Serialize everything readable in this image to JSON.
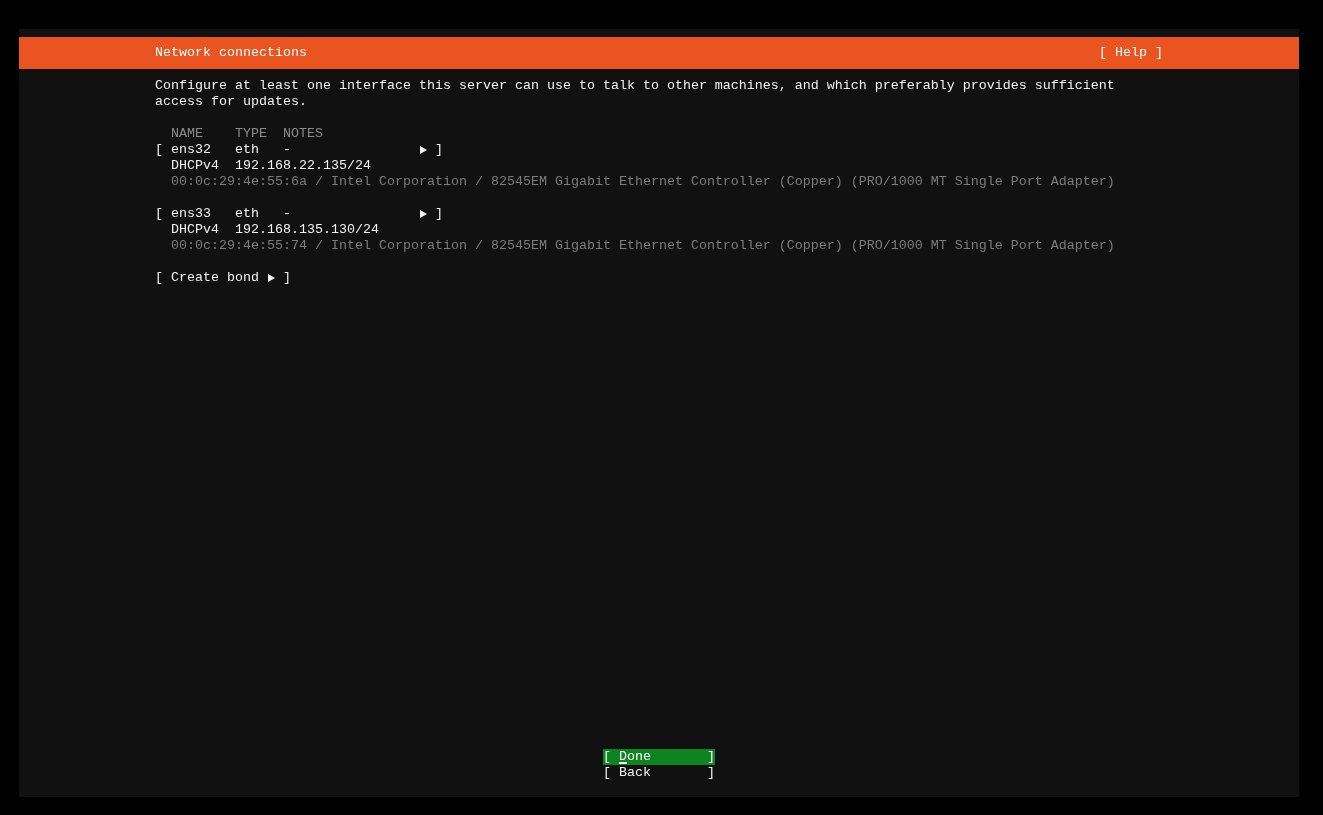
{
  "header": {
    "title": "Network connections",
    "help": "[ Help ]"
  },
  "intro": "Configure at least one interface this server can use to talk to other machines, and which preferably provides sufficient access for updates.",
  "table": {
    "columns": [
      "NAME",
      "TYPE",
      "NOTES"
    ],
    "interfaces": [
      {
        "open": "[",
        "name": "ens32",
        "type": "eth",
        "notes": "-",
        "close": "]",
        "addresses": [
          {
            "method": "DHCPv4",
            "address": "192.168.22.135/24"
          }
        ],
        "details": "00:0c:29:4e:55:6a / Intel Corporation / 82545EM Gigabit Ethernet Controller (Copper) (PRO/1000 MT Single Port Adapter)"
      },
      {
        "open": "[",
        "name": "ens33",
        "type": "eth",
        "notes": "-",
        "close": "]",
        "addresses": [
          {
            "method": "DHCPv4",
            "address": "192.168.135.130/24"
          }
        ],
        "details": "00:0c:29:4e:55:74 / Intel Corporation / 82545EM Gigabit Ethernet Controller (Copper) (PRO/1000 MT Single Port Adapter)"
      }
    ]
  },
  "create_bond": {
    "open": "[",
    "label": "Create bond",
    "close": "]"
  },
  "buttons": [
    {
      "open": "[",
      "label": "Done",
      "close": "]",
      "selected": true
    },
    {
      "open": "[",
      "label": "Back",
      "close": "]",
      "selected": false
    }
  ]
}
